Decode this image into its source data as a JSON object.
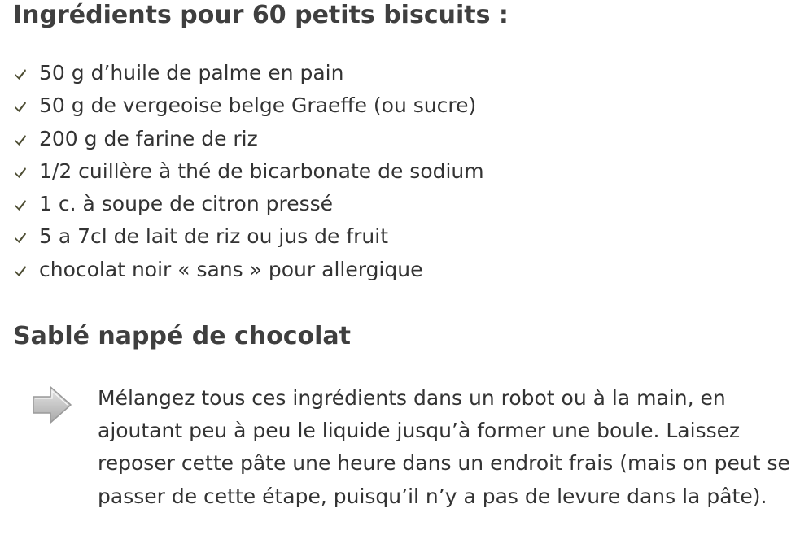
{
  "ingredients": {
    "title": "Ingrédients pour 60 petits biscuits :",
    "icon": "check-icon",
    "items": [
      "50 g d’huile de palme en pain",
      "50 g de vergeoise belge Graeffe (ou sucre)",
      "200 g de farine de riz",
      "1/2 cuillère à thé de bicarbonate de sodium",
      "1 c. à soupe de citron pressé",
      "5 a 7cl de lait de riz ou jus de fruit",
      "chocolat noir « sans » pour allergique"
    ]
  },
  "section": {
    "title": "Sablé nappé de chocolat",
    "icon": "arrow-right-icon",
    "text": "Mélangez tous ces ingrédients dans un robot ou à la main, en ajoutant peu à peu le liquide jusqu’à former une boule. Laissez reposer cette pâte une heure dans un endroit frais (mais on peut se passer de cette étape, puisqu’il n’y a pas de levure dans la pâte)."
  },
  "colors": {
    "heading": "#3f3f3f",
    "text": "#333333",
    "check": "#5a5a3a",
    "arrow": "#b8b8b8"
  }
}
